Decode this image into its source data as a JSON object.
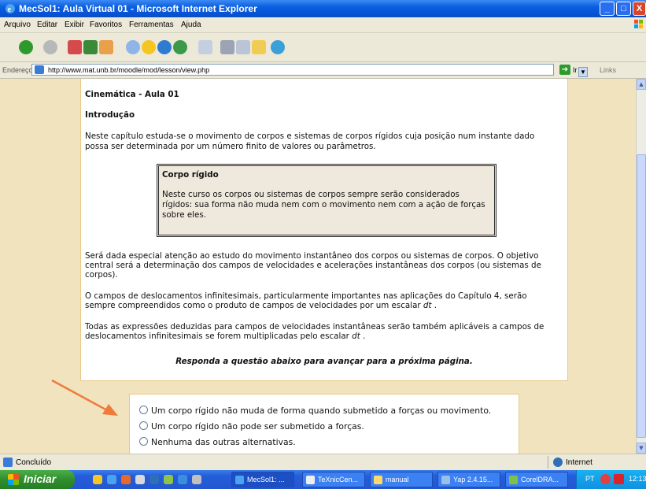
{
  "window": {
    "title": "MecSol1: Aula Virtual 01 - Microsoft Internet Explorer",
    "controls": {
      "minimize": "_",
      "maximize": "□",
      "close": "X"
    }
  },
  "menu": [
    "Arquivo",
    "Editar",
    "Exibir",
    "Favoritos",
    "Ferramentas",
    "Ajuda"
  ],
  "toolbar_icons": [
    "back-icon",
    "forward-icon",
    "stop-icon",
    "refresh-icon",
    "home-icon",
    "search-icon",
    "favorites-icon",
    "media-icon",
    "history-icon",
    "mail-icon",
    "print-icon",
    "edit-icon",
    "folder-icon",
    "messenger-icon"
  ],
  "address": {
    "label": "Endereço",
    "url": "http://www.mat.unb.br/moodle/mod/lesson/view.php",
    "go_label": "Ir",
    "links_label": "Links"
  },
  "lesson": {
    "heading": "Cinemática - Aula 01",
    "section": "Introdução",
    "intro": [
      "Neste capítulo estuda-se o movimento de corpos e sistemas de corpos rígidos cuja posição num instante dado",
      "possa ser determinada por um número finito de valores ou parâmetros."
    ],
    "box_title": "Corpo rígido",
    "box_text": [
      "Neste curso os corpos ou sistemas de corpos sempre serão considerados",
      "rígidos: sua forma não muda nem com o movimento nem com a ação de forças",
      "sobre eles."
    ],
    "para1": [
      "Será dada especial atenção ao estudo do movimento instantâneo dos corpos ou sistemas de corpos. O objetivo",
      "central será a determinação dos campos de velocidades e acelerações instantâneas dos corpos (ou sistemas de",
      "corpos)."
    ],
    "para2_line1": "O campos de deslocamentos infinitesimais, particularmente importantes nas aplicações do Capítulo 4, serão",
    "para2_line2_start": "sempre compreendidos como o produto de campos de velocidades por um escalar ",
    "para2_dt": "dt",
    "para2_line2_end": " .",
    "para3_line1": "Todas as expressões deduzidas para campos de velocidades instantâneas serão também aplicáveis a campos de",
    "para3_line2_start": "deslocamentos infinitesimais se forem multiplicadas pelo escalar ",
    "para3_dt": "dt",
    "para3_line2_end": " .",
    "instruction": "Responda a questão abaixo para avançar para a próxima página."
  },
  "question": {
    "options": [
      "Um corpo rígido não muda de forma quando submetido a forças ou movimento.",
      "Um corpo rígido não pode ser submetido a forças.",
      "Nenhuma das outras alternativas."
    ]
  },
  "status": {
    "text": "Concluído",
    "zone": "Internet"
  },
  "taskbar": {
    "start_label": "Iniciar",
    "tasks": [
      "MecSol1: ...",
      "TeXnicCen...",
      "manual",
      "Yap 2.4.15...",
      "CorelDRA..."
    ],
    "language": "PT",
    "clock": "12:13"
  },
  "colors": {
    "page_background": "#f1e3bd",
    "box_border": "#e8c889",
    "arrow": "#f07a3a",
    "titlebar": "#0a5fe0",
    "taskbar": "#245edb",
    "start_button": "#2f8e2d"
  }
}
